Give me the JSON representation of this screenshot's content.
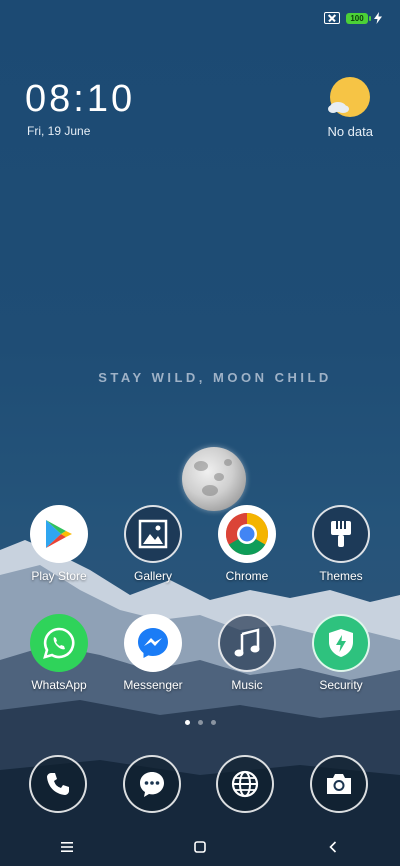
{
  "status": {
    "battery_level": "100"
  },
  "clock": {
    "time": "08:10",
    "date": "Fri, 19 June"
  },
  "weather": {
    "text": "No data",
    "icon": "sun-cloud-icon"
  },
  "wallpaper": {
    "quote": "STAY WILD, MOON CHILD"
  },
  "apps": {
    "play_store": "Play Store",
    "gallery": "Gallery",
    "chrome": "Chrome",
    "themes": "Themes",
    "whatsapp": "WhatsApp",
    "messenger": "Messenger",
    "music": "Music",
    "security": "Security"
  },
  "dock": [
    "phone-icon",
    "messages-icon",
    "browser-icon",
    "camera-icon"
  ],
  "pages": {
    "count": 3,
    "active": 1
  },
  "navigation": [
    "menu-icon",
    "home-icon",
    "back-icon"
  ],
  "colors": {
    "battery": "#4cd137",
    "weather_sun": "#f6c445",
    "whatsapp": "#2fd35a",
    "security": "#2ec27e",
    "messenger": "#1b7cf6"
  }
}
